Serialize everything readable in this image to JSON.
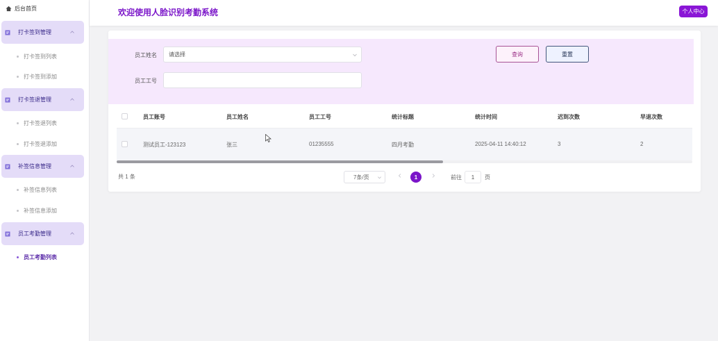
{
  "sidebar": {
    "home_label": "后台首页",
    "groups": [
      {
        "label": "打卡签到管理",
        "items": [
          "打卡签到列表",
          "打卡签到添加"
        ]
      },
      {
        "label": "打卡签退管理",
        "items": [
          "打卡签退列表",
          "打卡签退添加"
        ]
      },
      {
        "label": "补签信息管理",
        "items": [
          "补签信息列表",
          "补签信息添加"
        ]
      },
      {
        "label": "员工考勤管理",
        "items": [
          "员工考勤列表"
        ]
      }
    ]
  },
  "header": {
    "title": "欢迎使用人脸识别考勤系统",
    "user_button": "个人中心"
  },
  "filter": {
    "name_label": "员工姓名",
    "name_placeholder": "请选择",
    "id_label": "员工工号",
    "id_value": "",
    "query_button": "查询",
    "reset_button": "重置"
  },
  "table": {
    "headers": [
      "员工账号",
      "员工姓名",
      "员工工号",
      "统计标题",
      "统计时间",
      "迟到次数",
      "早退次数"
    ],
    "rows": [
      [
        "测试员工-123123",
        "张三",
        "01235555",
        "四月考勤",
        "2025-04-11 14:40:12",
        "3",
        "2"
      ]
    ]
  },
  "pagination": {
    "total": "共 1 条",
    "page_size": "7条/页",
    "current_page": "1",
    "goto_label": "前往",
    "goto_value": "1",
    "goto_unit": "页"
  },
  "colors": {
    "accent": "#7b16c9",
    "sidebar_group_bg": "#e4dcf8",
    "filter_bg": "#f6e8fd"
  }
}
